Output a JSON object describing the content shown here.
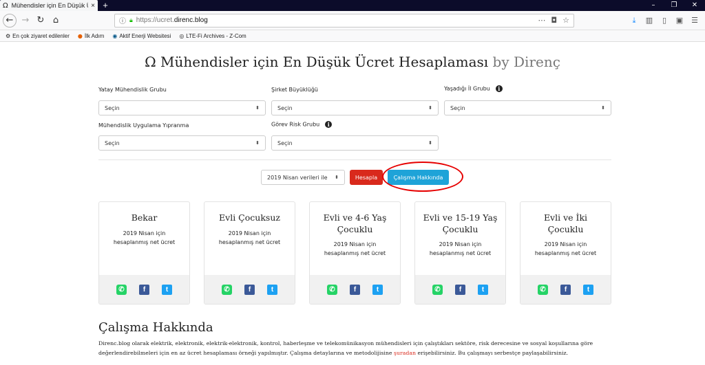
{
  "browser": {
    "tab_favicon": "Ω",
    "tab_title": "Mühendisler için En Düşük Ücre",
    "tab_close": "×",
    "new_tab": "+",
    "url_prefix": "https://ucret.",
    "url_host": "direnc.blog",
    "bookmarks": [
      {
        "icon": "gear-icon",
        "label": "En çok ziyaret edilenler"
      },
      {
        "icon": "firefox-icon",
        "label": "İlk Adım"
      },
      {
        "icon": "aktif-icon",
        "label": "Aktif Enerji Websitesi"
      },
      {
        "icon": "globe-icon",
        "label": "LTE-Fi Archives - Z-Com"
      }
    ]
  },
  "header": {
    "title_main": "Ω Mühendisler için En Düşük Ücret Hesaplaması",
    "title_by": "by Direnç"
  },
  "form": {
    "yatay_label": "Yatay Mühendislik Grubu",
    "sirket_label": "Şirket Büyüklüğü",
    "yasadigi_label": "Yaşadığı İl Grubu",
    "uygulama_label": "Mühendislik Uygulama Yıpranma",
    "gorev_label": "Görev Risk Grubu",
    "placeholder": "Seçin",
    "info_glyph": "i"
  },
  "actions": {
    "data_period": "2019 Nisan verileri ile",
    "calculate": "Hesapla",
    "about": "Çalışma Hakkında"
  },
  "cards": [
    {
      "title": "Bekar",
      "subtitle": "2019 Nisan için hesaplanmış net ücret"
    },
    {
      "title": "Evli Çocuksuz",
      "subtitle": "2019 Nisan için hesaplanmış net ücret"
    },
    {
      "title": "Evli ve 4-6 Yaş Çocuklu",
      "subtitle": "2019 Nisan için hesaplanmış net ücret"
    },
    {
      "title": "Evli ve 15-19 Yaş Çocuklu",
      "subtitle": "2019 Nisan için hesaplanmış net ücret"
    },
    {
      "title": "Evli ve İki Çocuklu",
      "subtitle": "2019 Nisan için hesaplanmış net ücret"
    }
  ],
  "share_icons": [
    "whatsapp-icon",
    "facebook-icon",
    "twitter-icon"
  ],
  "colors": {
    "calculate_button": "#d9291c",
    "about_button": "#1ea3d8",
    "highlight_circle": "#e60000",
    "link": "#d9291c"
  },
  "about": {
    "title": "Çalışma Hakkında",
    "text_1": "Direnc.blog olarak elektrik, elektronik, elektrik-elektronik, kontrol, haberleşme ve telekomünikasyon mühendisleri için çalıştıkları sektöre, risk derecesine ve sosyal koşullarına göre değerlendirebilmeleri için en az ücret hesaplaması örneği yapılmıştır. Çalışma detaylarına ve metodolijisine ",
    "link": "şuradan",
    "text_2": " erişebilirsiniz. Bu çalışmayı serbestçe paylaşabilirsiniz."
  }
}
